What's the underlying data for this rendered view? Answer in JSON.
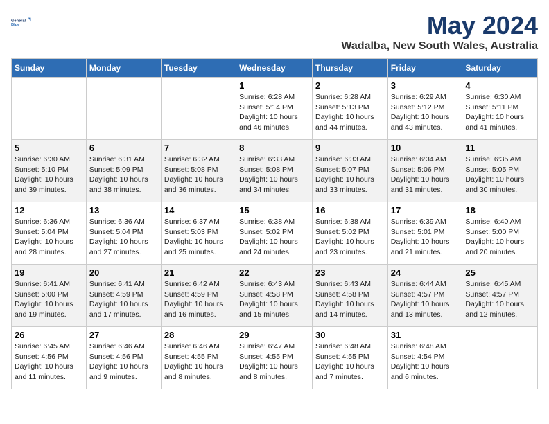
{
  "header": {
    "logo_line1": "General",
    "logo_line2": "Blue",
    "month": "May 2024",
    "location": "Wadalba, New South Wales, Australia"
  },
  "weekdays": [
    "Sunday",
    "Monday",
    "Tuesday",
    "Wednesday",
    "Thursday",
    "Friday",
    "Saturday"
  ],
  "weeks": [
    [
      {
        "day": "",
        "info": ""
      },
      {
        "day": "",
        "info": ""
      },
      {
        "day": "",
        "info": ""
      },
      {
        "day": "1",
        "info": "Sunrise: 6:28 AM\nSunset: 5:14 PM\nDaylight: 10 hours\nand 46 minutes."
      },
      {
        "day": "2",
        "info": "Sunrise: 6:28 AM\nSunset: 5:13 PM\nDaylight: 10 hours\nand 44 minutes."
      },
      {
        "day": "3",
        "info": "Sunrise: 6:29 AM\nSunset: 5:12 PM\nDaylight: 10 hours\nand 43 minutes."
      },
      {
        "day": "4",
        "info": "Sunrise: 6:30 AM\nSunset: 5:11 PM\nDaylight: 10 hours\nand 41 minutes."
      }
    ],
    [
      {
        "day": "5",
        "info": "Sunrise: 6:30 AM\nSunset: 5:10 PM\nDaylight: 10 hours\nand 39 minutes."
      },
      {
        "day": "6",
        "info": "Sunrise: 6:31 AM\nSunset: 5:09 PM\nDaylight: 10 hours\nand 38 minutes."
      },
      {
        "day": "7",
        "info": "Sunrise: 6:32 AM\nSunset: 5:08 PM\nDaylight: 10 hours\nand 36 minutes."
      },
      {
        "day": "8",
        "info": "Sunrise: 6:33 AM\nSunset: 5:08 PM\nDaylight: 10 hours\nand 34 minutes."
      },
      {
        "day": "9",
        "info": "Sunrise: 6:33 AM\nSunset: 5:07 PM\nDaylight: 10 hours\nand 33 minutes."
      },
      {
        "day": "10",
        "info": "Sunrise: 6:34 AM\nSunset: 5:06 PM\nDaylight: 10 hours\nand 31 minutes."
      },
      {
        "day": "11",
        "info": "Sunrise: 6:35 AM\nSunset: 5:05 PM\nDaylight: 10 hours\nand 30 minutes."
      }
    ],
    [
      {
        "day": "12",
        "info": "Sunrise: 6:36 AM\nSunset: 5:04 PM\nDaylight: 10 hours\nand 28 minutes."
      },
      {
        "day": "13",
        "info": "Sunrise: 6:36 AM\nSunset: 5:04 PM\nDaylight: 10 hours\nand 27 minutes."
      },
      {
        "day": "14",
        "info": "Sunrise: 6:37 AM\nSunset: 5:03 PM\nDaylight: 10 hours\nand 25 minutes."
      },
      {
        "day": "15",
        "info": "Sunrise: 6:38 AM\nSunset: 5:02 PM\nDaylight: 10 hours\nand 24 minutes."
      },
      {
        "day": "16",
        "info": "Sunrise: 6:38 AM\nSunset: 5:02 PM\nDaylight: 10 hours\nand 23 minutes."
      },
      {
        "day": "17",
        "info": "Sunrise: 6:39 AM\nSunset: 5:01 PM\nDaylight: 10 hours\nand 21 minutes."
      },
      {
        "day": "18",
        "info": "Sunrise: 6:40 AM\nSunset: 5:00 PM\nDaylight: 10 hours\nand 20 minutes."
      }
    ],
    [
      {
        "day": "19",
        "info": "Sunrise: 6:41 AM\nSunset: 5:00 PM\nDaylight: 10 hours\nand 19 minutes."
      },
      {
        "day": "20",
        "info": "Sunrise: 6:41 AM\nSunset: 4:59 PM\nDaylight: 10 hours\nand 17 minutes."
      },
      {
        "day": "21",
        "info": "Sunrise: 6:42 AM\nSunset: 4:59 PM\nDaylight: 10 hours\nand 16 minutes."
      },
      {
        "day": "22",
        "info": "Sunrise: 6:43 AM\nSunset: 4:58 PM\nDaylight: 10 hours\nand 15 minutes."
      },
      {
        "day": "23",
        "info": "Sunrise: 6:43 AM\nSunset: 4:58 PM\nDaylight: 10 hours\nand 14 minutes."
      },
      {
        "day": "24",
        "info": "Sunrise: 6:44 AM\nSunset: 4:57 PM\nDaylight: 10 hours\nand 13 minutes."
      },
      {
        "day": "25",
        "info": "Sunrise: 6:45 AM\nSunset: 4:57 PM\nDaylight: 10 hours\nand 12 minutes."
      }
    ],
    [
      {
        "day": "26",
        "info": "Sunrise: 6:45 AM\nSunset: 4:56 PM\nDaylight: 10 hours\nand 11 minutes."
      },
      {
        "day": "27",
        "info": "Sunrise: 6:46 AM\nSunset: 4:56 PM\nDaylight: 10 hours\nand 9 minutes."
      },
      {
        "day": "28",
        "info": "Sunrise: 6:46 AM\nSunset: 4:55 PM\nDaylight: 10 hours\nand 8 minutes."
      },
      {
        "day": "29",
        "info": "Sunrise: 6:47 AM\nSunset: 4:55 PM\nDaylight: 10 hours\nand 8 minutes."
      },
      {
        "day": "30",
        "info": "Sunrise: 6:48 AM\nSunset: 4:55 PM\nDaylight: 10 hours\nand 7 minutes."
      },
      {
        "day": "31",
        "info": "Sunrise: 6:48 AM\nSunset: 4:54 PM\nDaylight: 10 hours\nand 6 minutes."
      },
      {
        "day": "",
        "info": ""
      }
    ]
  ]
}
